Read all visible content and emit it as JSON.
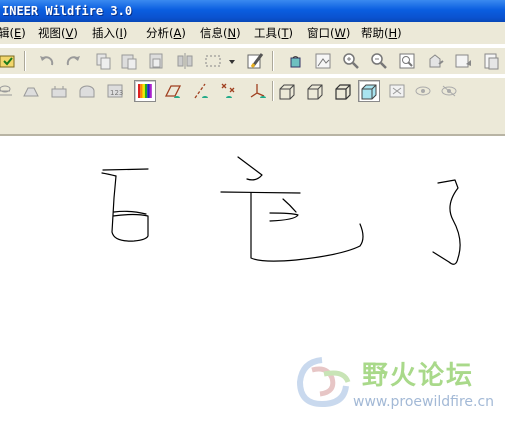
{
  "window": {
    "title": "INEER Wildfire 3.0"
  },
  "menu": [
    {
      "label": "辑",
      "key": "E"
    },
    {
      "label": "视图",
      "key": "V"
    },
    {
      "label": "插入",
      "key": "I"
    },
    {
      "label": "分析",
      "key": "A"
    },
    {
      "label": "信息",
      "key": "N"
    },
    {
      "label": "工具",
      "key": "T"
    },
    {
      "label": "窗口",
      "key": "W"
    },
    {
      "label": "帮助",
      "key": "H"
    }
  ],
  "toolbar_icons": {
    "row1": [
      "regenerate-icon",
      "undo-icon",
      "redo-icon",
      "copy-icon",
      "paste-icon",
      "paste-special-icon",
      "mirror-icon",
      "select-box-icon",
      "dropdown-arrow-icon",
      "repaint-icon",
      "bucket-icon",
      "view-settings-icon",
      "zoom-in-icon",
      "zoom-out-icon",
      "refit-icon",
      "orient-icon",
      "saved-views-icon",
      "layers-icon"
    ],
    "row2": [
      "datum-plane-icon",
      "datum-axis-icon",
      "datum-csys-icon",
      "datum-curve-icon",
      "spin-center-icon",
      "color-appearance-icon",
      "plane-display-icon",
      "axis-display-icon",
      "point-display-icon",
      "csys-display-icon",
      "wireframe-icon",
      "hidden-line-icon",
      "no-hidden-icon",
      "shading-icon",
      "model-tree-icon",
      "show-icon",
      "hide-icon"
    ]
  },
  "watermark": {
    "name": "野火论坛",
    "url": "www.proewildfire.cn"
  }
}
